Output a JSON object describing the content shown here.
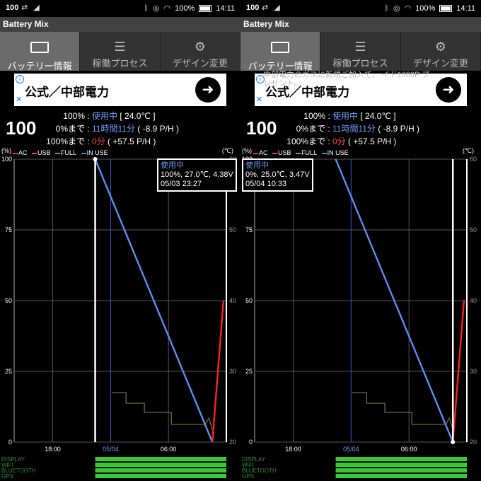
{
  "panels": [
    {
      "status_bar": {
        "left_badge": "100",
        "battery_pct": "100%",
        "time": "14:11"
      },
      "app_title": "Battery Mix",
      "tabs": [
        {
          "label": "バッテリー情報",
          "active": true,
          "icon": "battery-icon"
        },
        {
          "label": "稼働プロセス",
          "active": false,
          "icon": "list-icon"
        },
        {
          "label": "デザイン変更",
          "active": false,
          "icon": "gear-icon"
        }
      ],
      "ad": {
        "text": "公式／中部電力",
        "behind_text": ""
      },
      "level": "100",
      "info_rows": [
        {
          "key": "100%",
          "value": "使用中",
          "extra": "[ 24.0℃ ]"
        },
        {
          "key": "0%まで",
          "value": "11時間11分",
          "extra": "( -8.9 P/H )"
        },
        {
          "key": "100%まで",
          "value": "0分",
          "extra": "( +57.5 P/H )"
        }
      ],
      "tooltip": {
        "status": "使用中",
        "line1": "100%, 27.0℃, 4.38V",
        "line2": "05/03 23:27"
      }
    },
    {
      "status_bar": {
        "left_badge": "100",
        "battery_pct": "100%",
        "time": "14:11"
      },
      "app_title": "Battery Mix",
      "tabs": [
        {
          "label": "バッテリー情報",
          "active": true,
          "icon": "battery-icon"
        },
        {
          "label": "稼働プロセス",
          "active": false,
          "icon": "list-icon"
        },
        {
          "label": "デザイン変更",
          "active": false,
          "icon": "gear-icon"
        }
      ],
      "ad": {
        "text": "公式／中部電力",
        "behind_text": "中部電力のガスに新規ご加入で、 イド1000P プレゼント。"
      },
      "level": "100",
      "info_rows": [
        {
          "key": "100%",
          "value": "使用中",
          "extra": "[ 24.0℃ ]"
        },
        {
          "key": "0%まで",
          "value": "11時間11分",
          "extra": "( -8.9 P/H )"
        },
        {
          "key": "100%まで",
          "value": "0分",
          "extra": "( +57.5 P/H )"
        }
      ],
      "tooltip": {
        "status": "使用中",
        "line1": "0%, 25.0℃, 3.47V",
        "line2": "05/04 10:33"
      }
    }
  ],
  "legend": {
    "ac": "AC",
    "usb": "USB",
    "full": "FULL",
    "in_use": "IN USE"
  },
  "axis_units": {
    "left": "(%)",
    "right": "(℃)"
  },
  "colors": {
    "ac": "#ff3030",
    "usb": "#ff3030",
    "full": "#33cc33",
    "in_use": "#4a8cff",
    "line": "#5a8ff0",
    "temp": "#6e6e2a",
    "charge": "#ff2020"
  },
  "chart_data": {
    "type": "line",
    "x_ticks": [
      "18:00",
      "05/04",
      "06:00"
    ],
    "y_ticks_left": [
      "0",
      "25",
      "50",
      "75",
      "100"
    ],
    "y_ticks_right": [
      "20",
      "30",
      "40",
      "50",
      "60"
    ],
    "ylim_left": [
      0,
      100
    ],
    "ylim_right": [
      20,
      60
    ],
    "series": [
      {
        "name": "IN USE",
        "x_hours": [
          -1.6,
          10.55
        ],
        "values": [
          100,
          0
        ]
      },
      {
        "name": "AC",
        "x_hours": [
          10.55,
          11.7
        ],
        "values": [
          0,
          50
        ]
      }
    ],
    "x_hours_range": [
      -10,
      12
    ],
    "tick_hours": [
      -6,
      0,
      6
    ],
    "status_rows": [
      "DISPLAY",
      "WIFI",
      "BLUETOOTH",
      "GPS"
    ]
  }
}
